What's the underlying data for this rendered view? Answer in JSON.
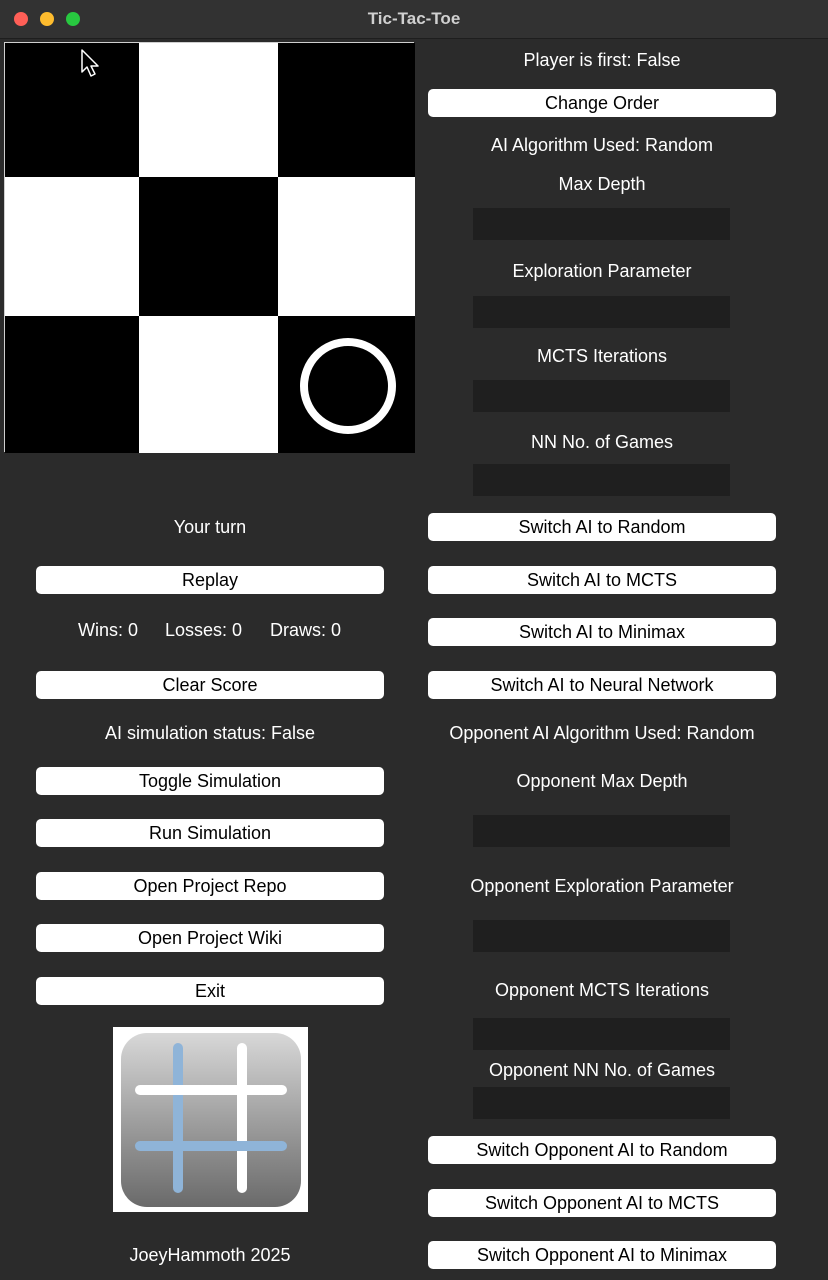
{
  "window": {
    "title": "Tic-Tac-Toe"
  },
  "board": {
    "cells": [
      {
        "color": "black",
        "mark": ""
      },
      {
        "color": "white",
        "mark": ""
      },
      {
        "color": "black",
        "mark": ""
      },
      {
        "color": "white",
        "mark": ""
      },
      {
        "color": "black",
        "mark": ""
      },
      {
        "color": "white",
        "mark": ""
      },
      {
        "color": "black",
        "mark": ""
      },
      {
        "color": "white",
        "mark": ""
      },
      {
        "color": "black",
        "mark": "O"
      }
    ]
  },
  "game": {
    "turn_text": "Your turn",
    "replay_label": "Replay",
    "wins_text": "Wins: 0",
    "losses_text": "Losses: 0",
    "draws_text": "Draws: 0",
    "clear_score_label": "Clear Score",
    "simulation_status": "AI simulation status: False",
    "toggle_simulation_label": "Toggle Simulation",
    "run_simulation_label": "Run Simulation",
    "open_repo_label": "Open Project Repo",
    "open_wiki_label": "Open Project Wiki",
    "exit_label": "Exit",
    "credit": "JoeyHammoth 2025"
  },
  "ai": {
    "player_first": "Player is first: False",
    "change_order_label": "Change Order",
    "algorithm_used": "AI Algorithm Used: Random",
    "max_depth_label": "Max Depth",
    "exploration_label": "Exploration Parameter",
    "mcts_iterations_label": "MCTS Iterations",
    "nn_games_label": "NN No. of Games",
    "switch_random": "Switch AI to Random",
    "switch_mcts": "Switch AI to MCTS",
    "switch_minimax": "Switch AI to Minimax",
    "switch_nn": "Switch AI to Neural Network"
  },
  "opponent": {
    "algorithm_used": "Opponent AI Algorithm Used: Random",
    "max_depth_label": "Opponent Max Depth",
    "exploration_label": "Opponent Exploration Parameter",
    "mcts_iterations_label": "Opponent MCTS Iterations",
    "nn_games_label": "Opponent NN No. of Games",
    "switch_random": "Switch Opponent AI to Random",
    "switch_mcts": "Switch Opponent AI to MCTS",
    "switch_minimax": "Switch Opponent AI to Minimax"
  }
}
